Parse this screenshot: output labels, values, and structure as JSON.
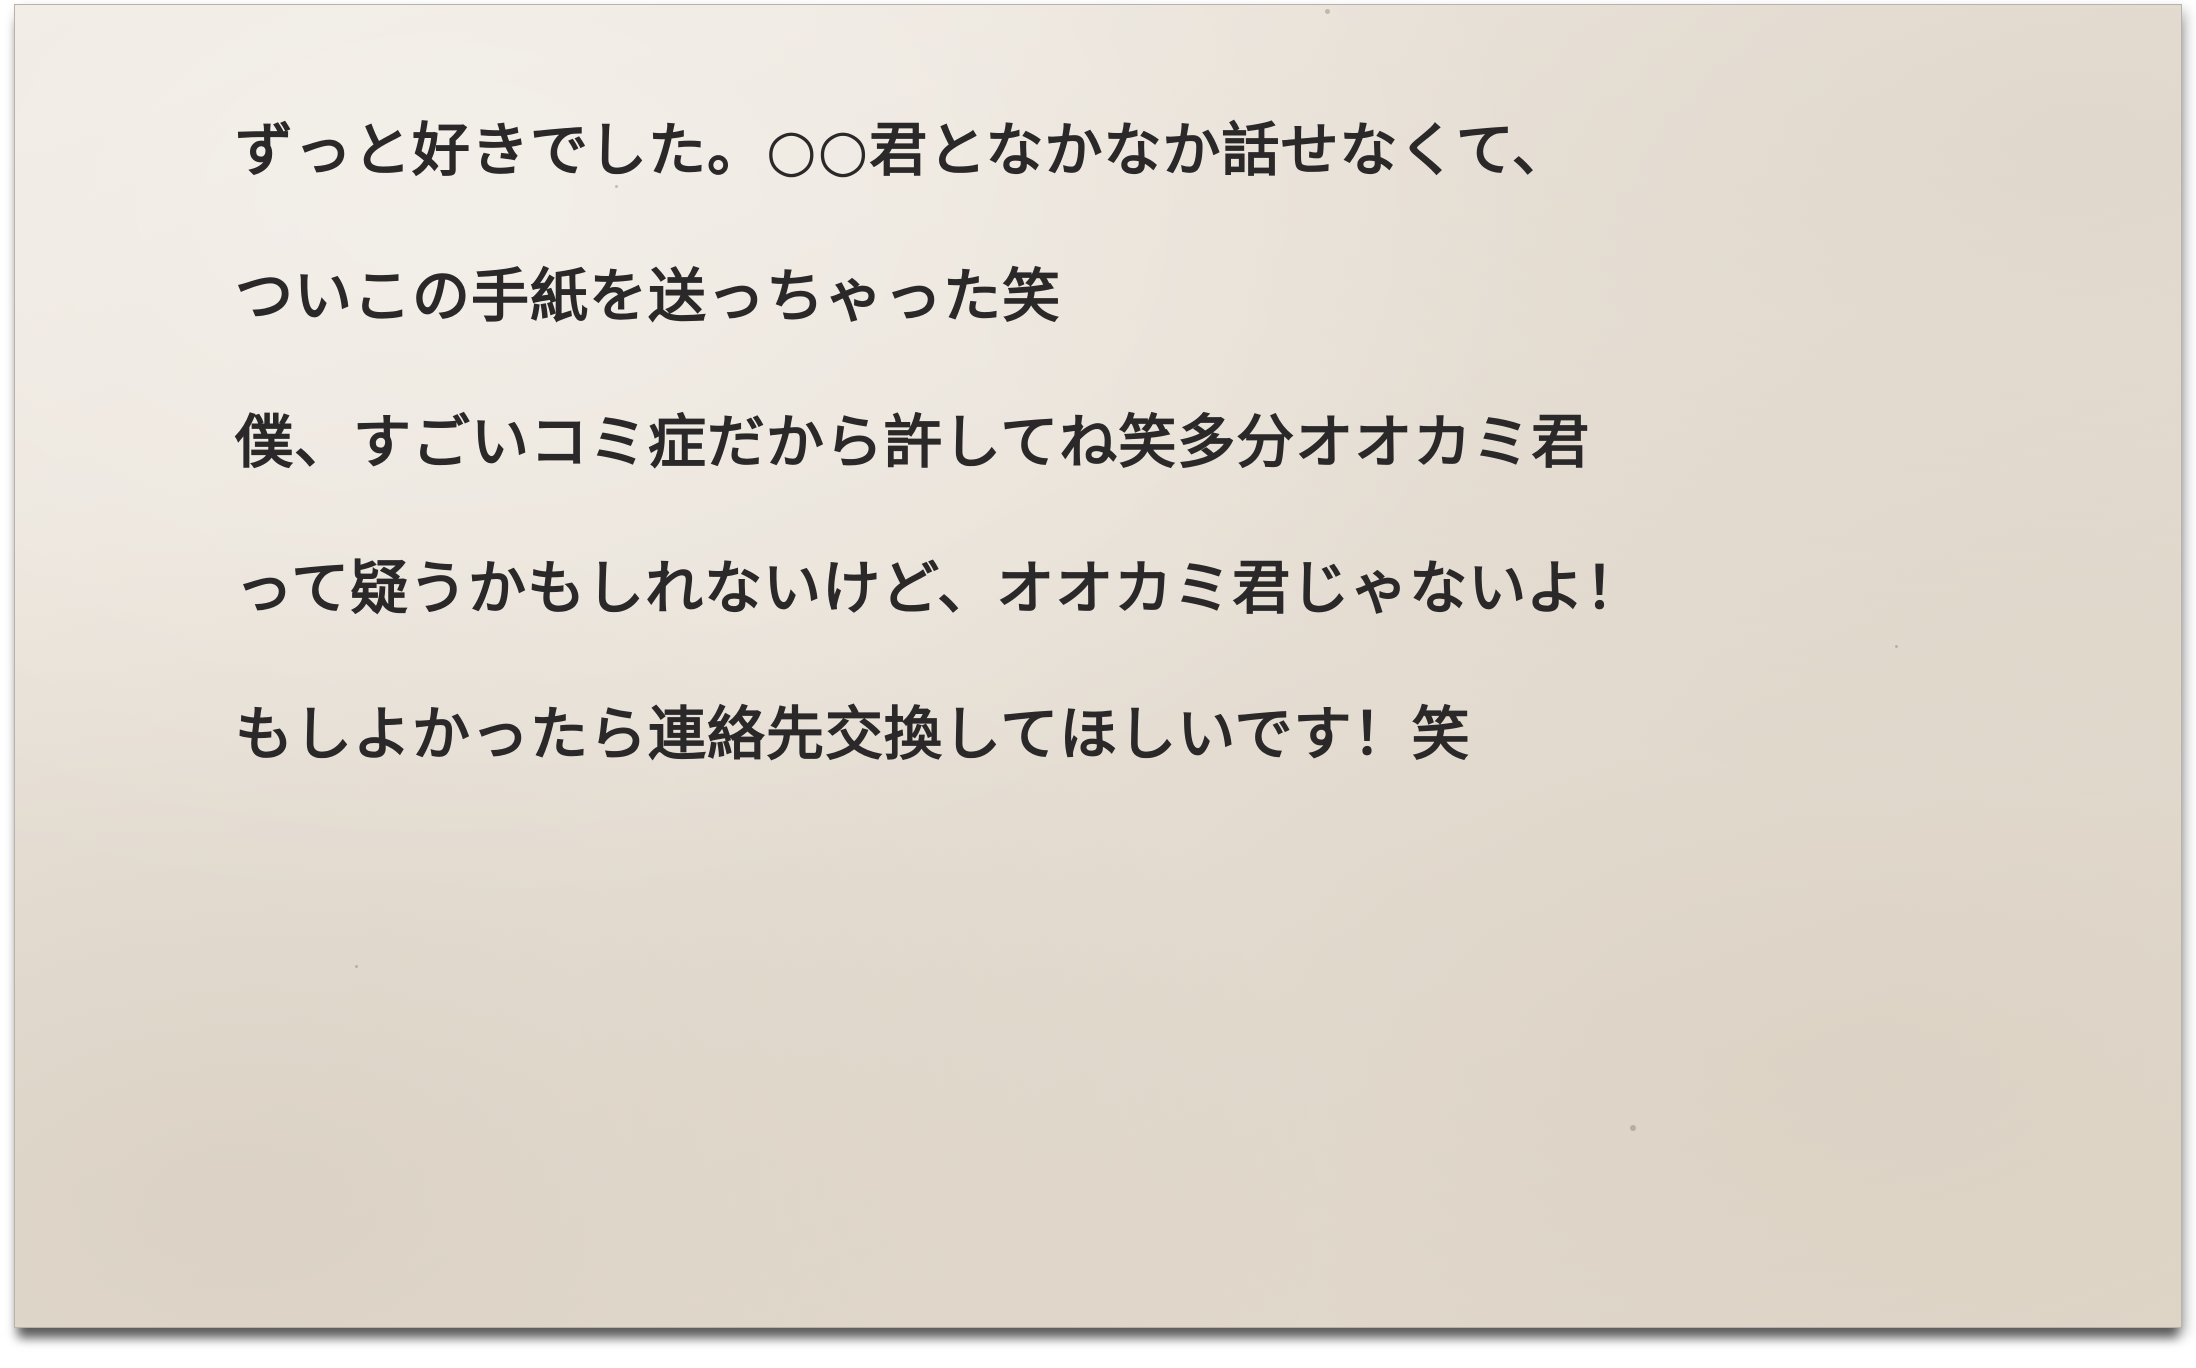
{
  "letter": {
    "lines": [
      "ずっと好きでした。○○君となかなか話せなくて、",
      "ついこの手紙を送っちゃった笑",
      "僕、すごいコミ症だから許してね笑多分オオカミ君",
      "って疑うかもしれないけど、オオカミ君じゃないよ！",
      "もしよかったら連絡先交換してほしいです！笑"
    ]
  }
}
